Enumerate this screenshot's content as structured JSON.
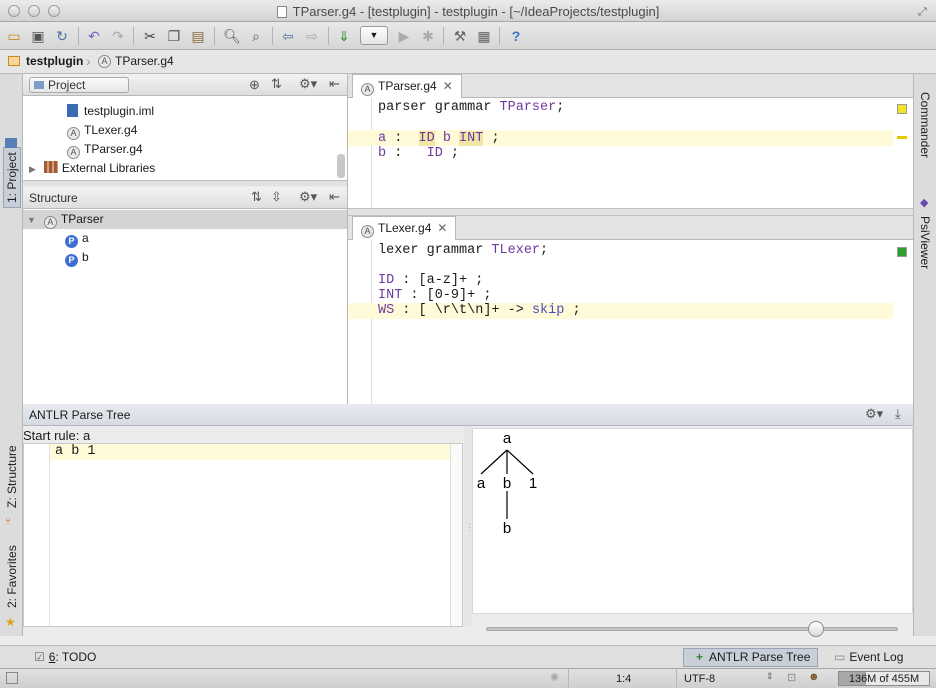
{
  "window": {
    "title": "TParser.g4 - [testplugin] - testplugin - [~/IdeaProjects/testplugin]"
  },
  "toolbar": {
    "icons": [
      "open-icon",
      "save-icon",
      "sync-icon",
      "undo-icon",
      "redo-icon",
      "cut-icon",
      "copy-icon",
      "paste-icon",
      "find-icon",
      "replace-icon",
      "back-icon",
      "forward-icon",
      "make-icon",
      "run-config-combo",
      "run-icon",
      "debug-icon",
      "settings-icon",
      "project-structure-icon",
      "help-icon"
    ],
    "help_glyph": "?"
  },
  "breadcrumb": {
    "project": "testplugin",
    "file": "TParser.g4"
  },
  "left_tool_tabs": {
    "project": "1: Project",
    "structure": "Z: Structure",
    "favorites": "2: Favorites"
  },
  "right_tool_tabs": {
    "commander": "Commander",
    "psiviewer": "PsiViewer"
  },
  "project_panel": {
    "view_selector": "Project",
    "items": [
      {
        "label": "testplugin.iml",
        "icon": "iml-file-icon"
      },
      {
        "label": "TLexer.g4",
        "icon": "antlr-file-icon"
      },
      {
        "label": "TParser.g4",
        "icon": "antlr-file-icon"
      },
      {
        "label": "External Libraries",
        "icon": "library-icon"
      }
    ]
  },
  "structure_panel": {
    "title": "Structure",
    "root": "TParser",
    "children": [
      "a",
      "b"
    ]
  },
  "editor_top": {
    "tab": "TParser.g4",
    "lines": {
      "l1_kw": "parser grammar ",
      "l1_name": "TParser",
      "l1_end": ";",
      "l3_rule": "a",
      "l3_colon": " :  ",
      "l3_id": "ID",
      "l3_b": " b ",
      "l3_int": "INT",
      "l3_end": " ;",
      "l4_rule": "b",
      "l4_colon": " :   ",
      "l4_id": "ID",
      "l4_end": " ;"
    }
  },
  "editor_bottom": {
    "tab": "TLexer.g4",
    "lines": {
      "l1_kw": "lexer grammar ",
      "l1_name": "TLexer",
      "l1_end": ";",
      "l3_tok": "ID",
      "l3_rest": " : [a-z]+ ;",
      "l4_tok": "INT",
      "l4_rest": " : [0-9]+ ;",
      "l5_tok": "WS",
      "l5_rest": " : [ \\r\\t\\n]+ -> ",
      "l5_skip": "skip",
      "l5_end": " ;"
    }
  },
  "parse_tree_panel": {
    "title": "ANTLR Parse Tree",
    "start_rule": "Start rule: a",
    "input": "a b 1",
    "tree": {
      "root": "a",
      "children": [
        "a",
        "b",
        "1"
      ],
      "grandchild": "b"
    },
    "zoom_slider": 0.8
  },
  "tool_window_bar": {
    "todo_num": "6",
    "todo_label": ": TODO",
    "parse_tree_button": "ANTLR Parse Tree",
    "event_log": "Event Log"
  },
  "status": {
    "position": "1:4",
    "encoding": "UTF-8",
    "memory": "136M of 455M",
    "memory_fraction": 0.3
  },
  "colors": {
    "highlight_line": "#fffbd9",
    "rule_purple": "#6e3a9e",
    "tree_icon_blue": "#3f6fd1",
    "ok_marker_green": "#2da02d",
    "warning_marker_yellow": "#f5e52a"
  }
}
